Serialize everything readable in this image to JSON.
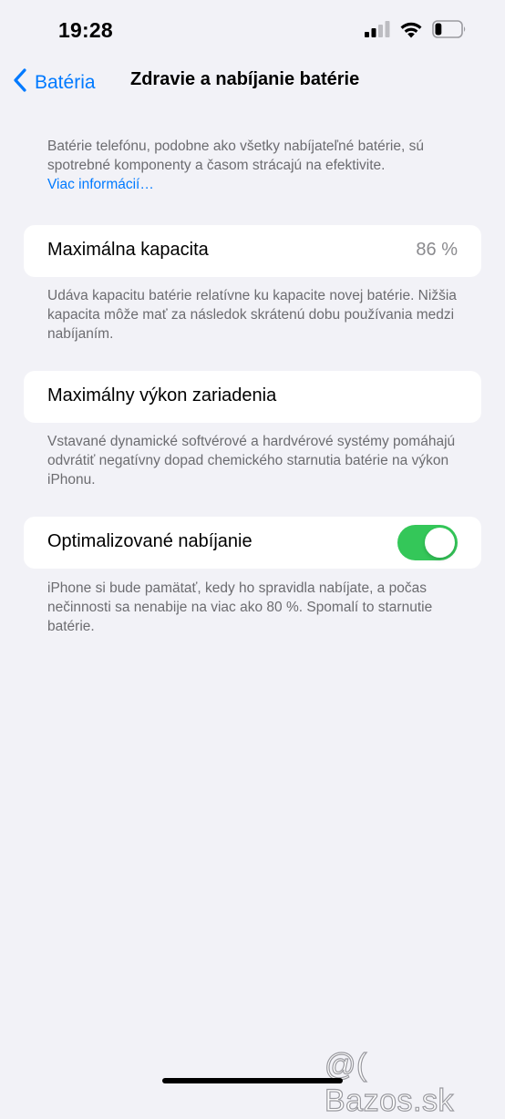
{
  "status_bar": {
    "time": "19:28",
    "icons": [
      "cellular-signal-icon",
      "wifi-icon",
      "battery-icon"
    ],
    "battery_level": 0.25
  },
  "nav": {
    "back_label": "Batéria",
    "title": "Zdravie a nabíjanie batérie"
  },
  "intro": {
    "text": "Batérie telefónu, podobne ako všetky nabíjateľné batérie, sú spotrebné komponenty a časom strácajú na efektivite.",
    "link": "Viac informácií…"
  },
  "max_capacity": {
    "label": "Maximálna kapacita",
    "value": "86 %",
    "footnote": "Udáva kapacitu batérie relatívne ku kapacite novej batérie. Nižšia kapacita môže mať za následok skrátenú dobu používania medzi nabíjaním."
  },
  "peak_performance": {
    "label": "Maximálny výkon zariadenia",
    "footnote": "Vstavané dynamické softvérové a hardvérové systémy pomáhajú odvrátiť negatívny dopad chemického starnutia batérie na výkon iPhonu."
  },
  "optimized_charging": {
    "label": "Optimalizované nabíjanie",
    "enabled": true,
    "footnote": "iPhone si bude pamätať, kedy ho spravidla nabíjate, a počas nečinnosti sa nenabije na viac ako 80 %. Spomalí to starnutie batérie."
  },
  "watermark": "@( Bazos.sk",
  "colors": {
    "accent": "#007AFF",
    "toggle_on": "#34C759",
    "background": "#F2F2F7",
    "secondary_text": "#6C6C70"
  }
}
